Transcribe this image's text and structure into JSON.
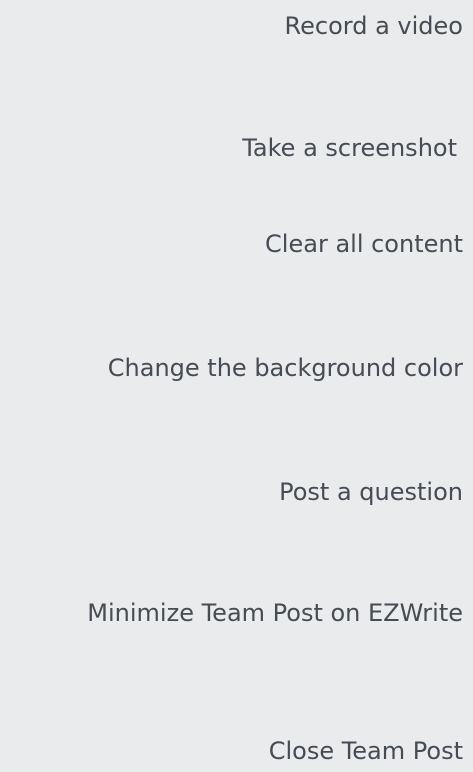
{
  "menu": {
    "items": [
      {
        "label": "Record a video"
      },
      {
        "label": "Take a screenshot"
      },
      {
        "label": "Clear all content"
      },
      {
        "label": "Change the background color"
      },
      {
        "label": "Post a question"
      },
      {
        "label": "Minimize Team Post on EZWrite"
      },
      {
        "label": "Close Team Post"
      }
    ]
  }
}
